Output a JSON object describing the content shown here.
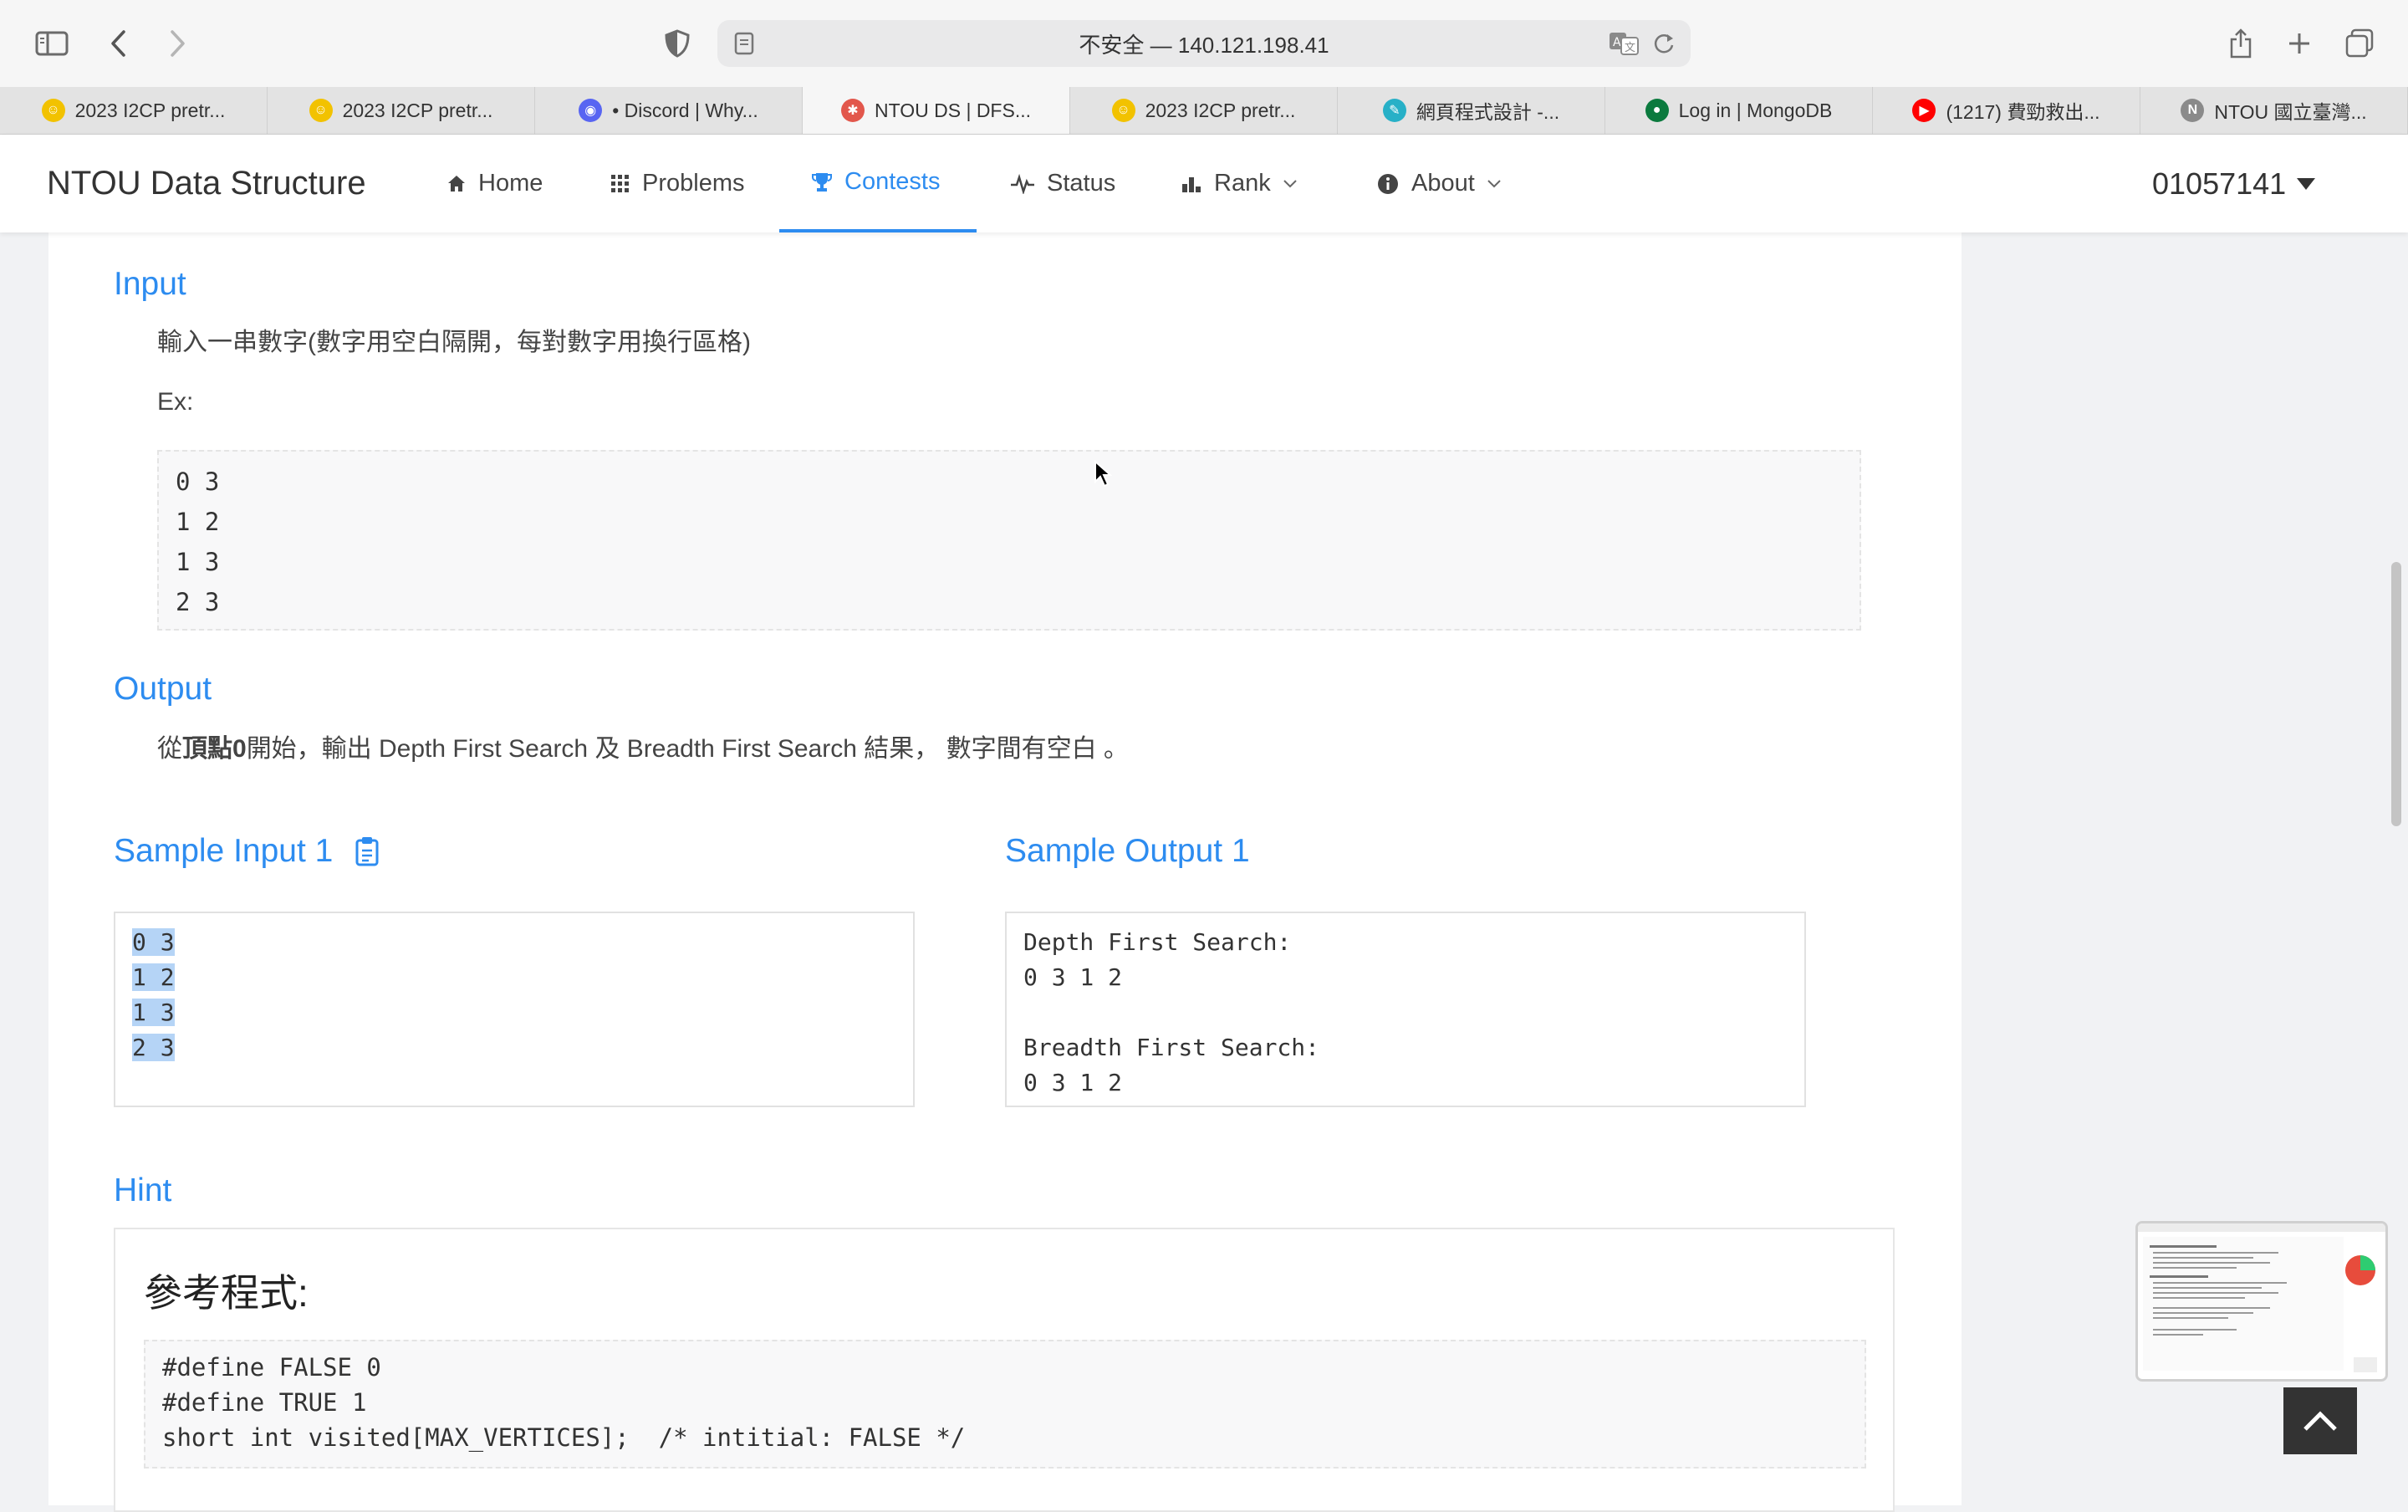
{
  "browser": {
    "url": "不安全 — 140.121.198.41",
    "tabs": [
      {
        "label": "2023 I2CP pretr...",
        "icon": "smiley-icon",
        "color": "#f2c200"
      },
      {
        "label": "2023 I2CP pretr...",
        "icon": "smiley-icon",
        "color": "#f2c200"
      },
      {
        "label": "• Discord | Why...",
        "icon": "discord-icon",
        "color": "#5865f2"
      },
      {
        "label": "NTOU DS | DFS...",
        "icon": "ntou-icon",
        "color": "#e2574c",
        "active": true
      },
      {
        "label": "2023 I2CP pretr...",
        "icon": "smiley-icon",
        "color": "#f2c200"
      },
      {
        "label": "網頁程式設計 -...",
        "icon": "feather-icon",
        "color": "#27b0c7"
      },
      {
        "label": "Log in | MongoDB",
        "icon": "mongodb-icon",
        "color": "#0b7a3e"
      },
      {
        "label": "(1217) 費勁救出...",
        "icon": "youtube-icon",
        "color": "#ff0000"
      },
      {
        "label": "NTOU 國立臺灣...",
        "icon": "notion-icon",
        "color": "#8a8a8a"
      }
    ]
  },
  "nav": {
    "brand": "NTOU Data Structure",
    "items": [
      {
        "label": "Home",
        "icon": "home-icon"
      },
      {
        "label": "Problems",
        "icon": "grid-icon"
      },
      {
        "label": "Contests",
        "icon": "trophy-icon",
        "active": true
      },
      {
        "label": "Status",
        "icon": "pulse-icon"
      },
      {
        "label": "Rank",
        "icon": "bar-chart-icon"
      },
      {
        "label": "About",
        "icon": "info-icon"
      }
    ],
    "user": "01057141"
  },
  "problem": {
    "input_title": "Input",
    "input_desc": "輸入一串數字(數字用空白隔開，每對數字用換行區格)",
    "ex_label": "Ex:",
    "ex_lines": [
      "0 3",
      "1 2",
      "1 3",
      "2 3"
    ],
    "output_title": "Output",
    "output_pre": "從",
    "output_bold": "頂點0",
    "output_post": "開始，輸出 Depth First Search 及 Breadth First Search 結果， 數字間有空白 。",
    "sample_input_title": "Sample Input 1",
    "sample_input_lines": [
      "0 3",
      "1 2",
      "1 3",
      "2 3"
    ],
    "sample_output_title": "Sample Output 1",
    "sample_output_lines": [
      "Depth First Search:",
      "0 3 1 2",
      "",
      "Breadth First Search:",
      "0 3 1 2"
    ],
    "hint_title": "Hint",
    "hint_heading": "參考程式:",
    "hint_code": [
      "#define FALSE 0",
      "#define TRUE 1",
      "short int visited[MAX_VERTICES];  /* intitial: FALSE */"
    ]
  },
  "colors": {
    "accent": "#2d8cf0",
    "selection": "#b5d4f6"
  }
}
